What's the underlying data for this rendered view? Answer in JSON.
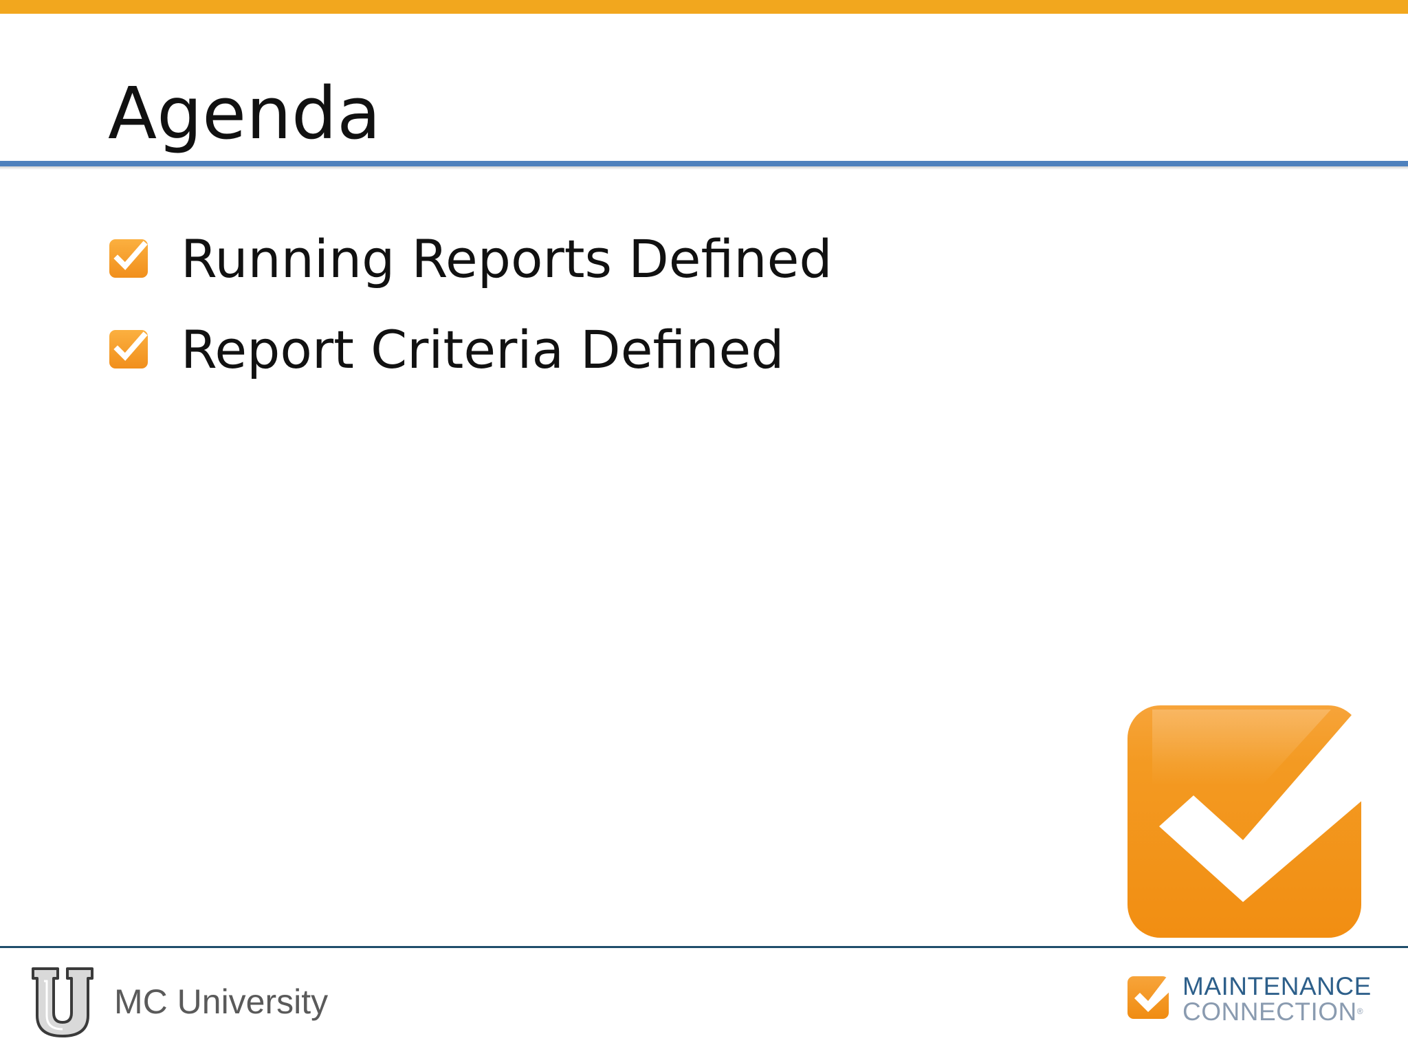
{
  "slide": {
    "title": "Agenda",
    "items": [
      {
        "label": "Running Reports Defined",
        "checked": true
      },
      {
        "label": "Report Criteria Defined",
        "checked": true
      }
    ]
  },
  "footer": {
    "left_text": "MC University",
    "brand_line1": "MAINTENANCE",
    "brand_line2": "CONNECTION",
    "brand_reg": "®"
  },
  "colors": {
    "accent_orange": "#f2a71e",
    "title_rule_blue": "#4f81bd",
    "footer_rule": "#1f4e6b",
    "brand_blue": "#2d5f8a"
  },
  "icons": {
    "bullet": "checkbox-checked-icon",
    "hero": "large-checkmark-icon",
    "footer_left": "university-u-logo",
    "footer_right": "maintenance-connection-logo"
  }
}
